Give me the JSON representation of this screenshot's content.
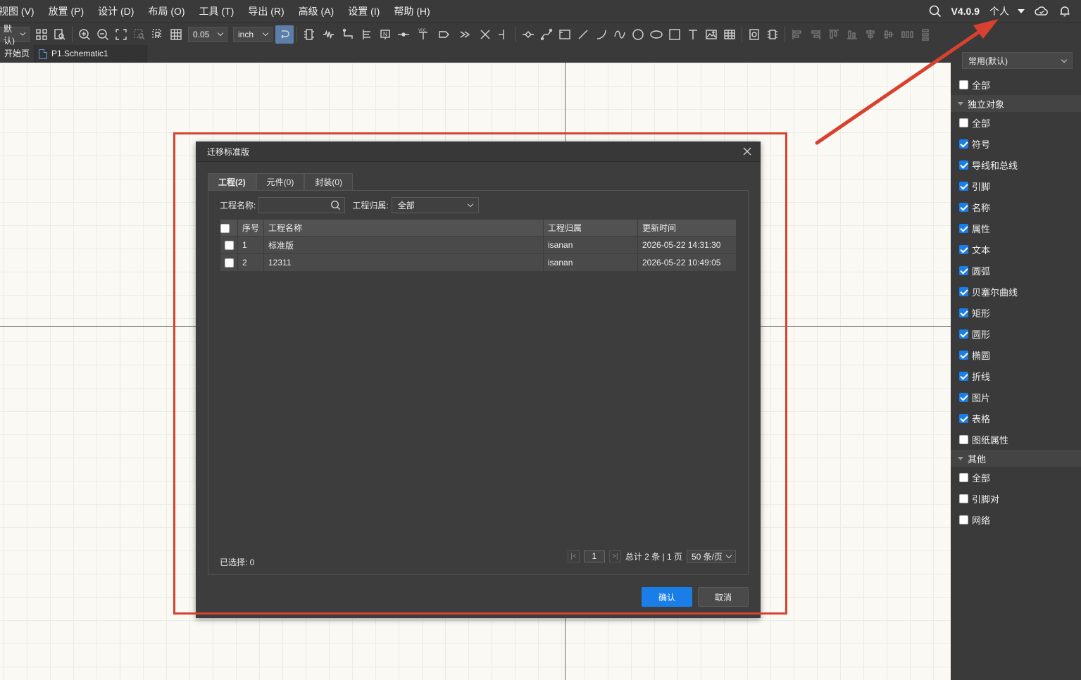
{
  "menubar": {
    "items": [
      "视图 (V)",
      "放置 (P)",
      "设计 (D)",
      "布局 (O)",
      "工具 (T)",
      "导出 (R)",
      "高级 (A)",
      "设置 (I)",
      "帮助 (H)"
    ],
    "version": "V4.0.9",
    "user_label": "个人"
  },
  "toolbar": {
    "theme_select": "默认)",
    "grid_value": "0.05",
    "unit_value": "inch"
  },
  "doc_tabs": [
    {
      "label": "开始页"
    },
    {
      "label": "P1.Schematic1"
    }
  ],
  "filter_panel": {
    "mode_select": "常用(默认)",
    "top_all": "全部",
    "groups": [
      {
        "title": "独立对象",
        "items": [
          {
            "label": "全部",
            "checked": false
          },
          {
            "label": "符号",
            "checked": true
          },
          {
            "label": "导线和总线",
            "checked": true
          },
          {
            "label": "引脚",
            "checked": true
          },
          {
            "label": "名称",
            "checked": true
          },
          {
            "label": "属性",
            "checked": true
          },
          {
            "label": "文本",
            "checked": true
          },
          {
            "label": "圆弧",
            "checked": true
          },
          {
            "label": "贝塞尔曲线",
            "checked": true
          },
          {
            "label": "矩形",
            "checked": true
          },
          {
            "label": "圆形",
            "checked": true
          },
          {
            "label": "椭圆",
            "checked": true
          },
          {
            "label": "折线",
            "checked": true
          },
          {
            "label": "图片",
            "checked": true
          },
          {
            "label": "表格",
            "checked": true
          },
          {
            "label": "图纸属性",
            "checked": false
          }
        ]
      },
      {
        "title": "其他",
        "items": [
          {
            "label": "全部",
            "checked": false
          },
          {
            "label": "引脚对",
            "checked": false
          },
          {
            "label": "网络",
            "checked": false
          }
        ]
      }
    ]
  },
  "dialog": {
    "title": "迁移标准版",
    "tabs": [
      "工程(2)",
      "元件(0)",
      "封装(0)"
    ],
    "filter": {
      "name_label": "工程名称:",
      "name_value": "",
      "owner_label": "工程归属:",
      "owner_value": "全部"
    },
    "table": {
      "headers": [
        "序号",
        "工程名称",
        "工程归属",
        "更新时间"
      ],
      "rows": [
        {
          "index": "1",
          "name": "标准版",
          "owner": "isanan",
          "updated": "2026-05-22 14:31:30"
        },
        {
          "index": "2",
          "name": "12311",
          "owner": "isanan",
          "updated": "2026-05-22 10:49:05"
        }
      ]
    },
    "selected_text": "已选择: 0",
    "pager": {
      "current_page": "1",
      "summary": "总计 2 条 | 1 页",
      "page_size": "50 条/页"
    },
    "confirm_label": "确认",
    "cancel_label": "取消"
  },
  "annotation_color": "#d8412f",
  "accent_color": "#1a7ee8"
}
